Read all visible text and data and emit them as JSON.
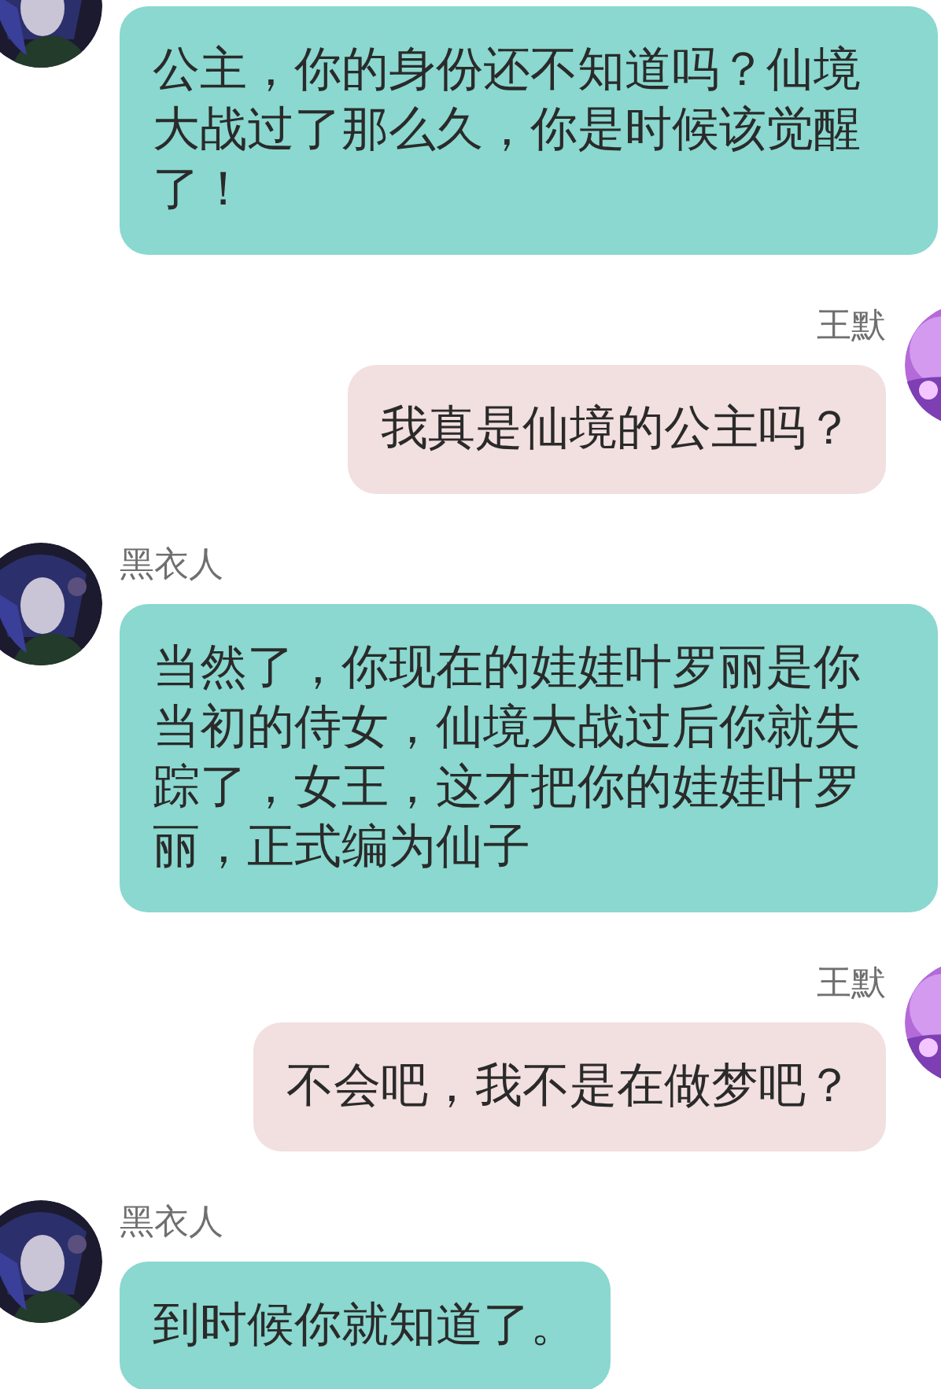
{
  "messages": [
    {
      "kind": "incoming",
      "text": "公主，你的身份还不知道吗？仙境大战过了那么久，你是时候该觉醒了！"
    },
    {
      "kind": "outgoing",
      "sender": "王默",
      "text": "我真是仙境的公主吗？"
    },
    {
      "kind": "incoming",
      "sender": "黑衣人",
      "text": "当然了，你现在的娃娃叶罗丽是你当初的侍女，仙境大战过后你就失踪了，女王，这才把你的娃娃叶罗丽，正式编为仙子"
    },
    {
      "kind": "outgoing",
      "sender": "王默",
      "text": "不会吧，我不是在做梦吧？"
    },
    {
      "kind": "incoming",
      "sender": "黑衣人",
      "text": "到时候你就知道了。"
    }
  ]
}
